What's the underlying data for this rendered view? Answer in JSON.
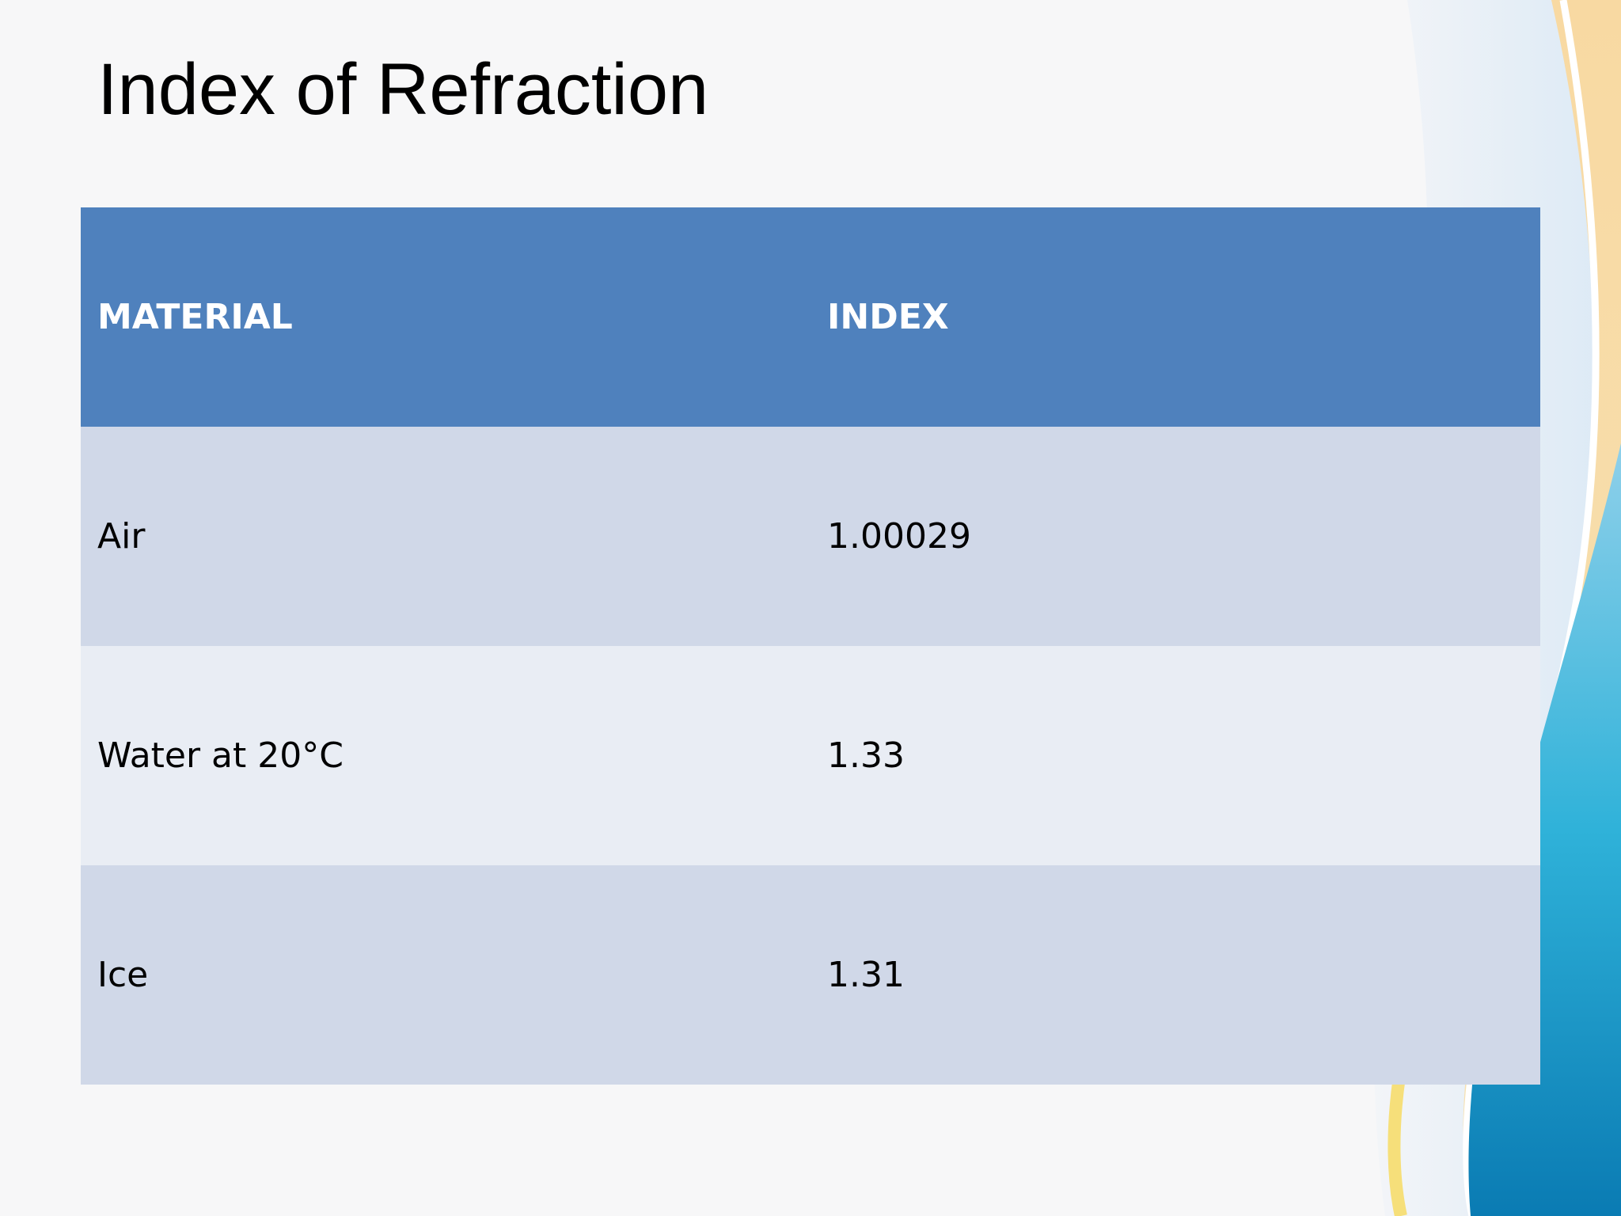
{
  "slide": {
    "title": "Index of Refraction"
  },
  "table": {
    "headers": [
      "MATERIAL",
      "INDEX"
    ],
    "rows": [
      [
        "Air",
        "1.00029"
      ],
      [
        "Water at 20°C",
        "1.33"
      ],
      [
        "Ice",
        "1.31"
      ]
    ]
  },
  "colors": {
    "header_background": "#4f81bd",
    "row_band_dark": "#d0d8e8",
    "row_band_light": "#e9edf4",
    "header_text": "#ffffff",
    "body_text": "#000000"
  }
}
